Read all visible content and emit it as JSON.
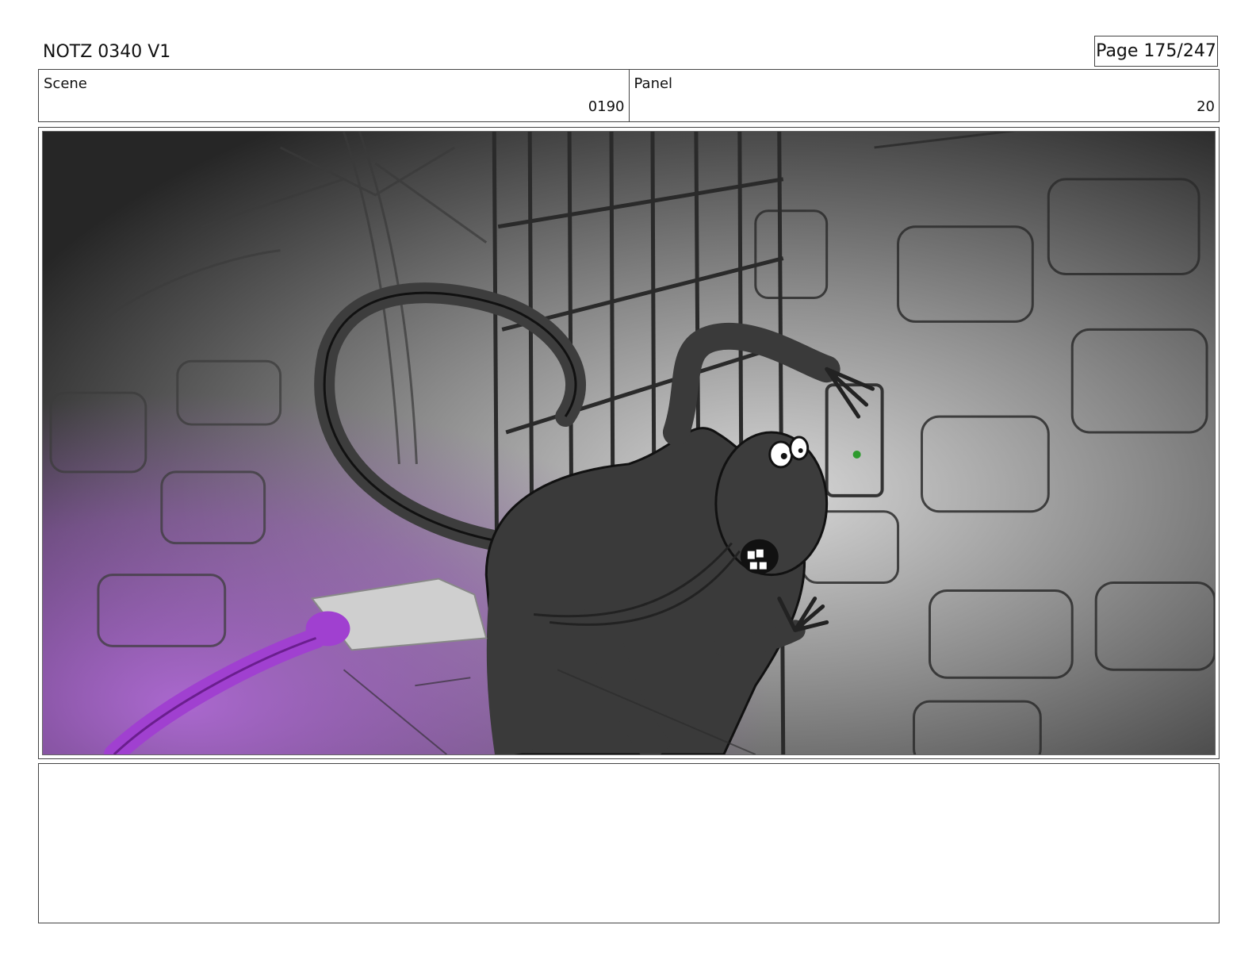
{
  "document": {
    "title": "NOTZ 0340 V1",
    "page": "Page 175/247"
  },
  "info": {
    "scene_label": "Scene",
    "scene_value": "0190",
    "panel_label": "Panel",
    "panel_value": "20"
  },
  "artwork": {
    "kind": "storyboard-sketch",
    "accent_color": "#a040d0",
    "eye_light_color": "#2e9a2e"
  },
  "notes": {
    "text": ""
  }
}
